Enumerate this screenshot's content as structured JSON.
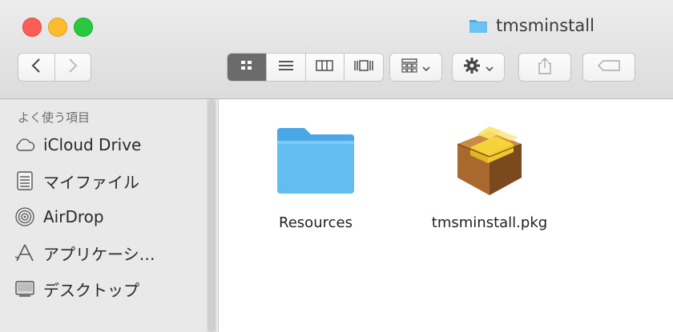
{
  "window": {
    "title": "tmsminstall"
  },
  "toolbar": {
    "back_icon": "chevron-left-icon",
    "forward_icon": "chevron-right-icon",
    "view_modes": [
      "icon-view-icon",
      "list-view-icon",
      "column-view-icon",
      "cover-flow-icon"
    ],
    "active_view": "icon-view-icon",
    "arrange_icon": "arrange-grid-icon",
    "action_icon": "gear-icon",
    "share_icon": "share-icon",
    "tag_icon": "tag-icon"
  },
  "sidebar": {
    "section_header": "よく使う項目",
    "items": [
      {
        "label": "iCloud Drive",
        "icon": "cloud-icon"
      },
      {
        "label": "マイファイル",
        "icon": "all-my-files-icon"
      },
      {
        "label": "AirDrop",
        "icon": "airdrop-icon"
      },
      {
        "label": "アプリケーシ…",
        "icon": "applications-icon"
      },
      {
        "label": "デスクトップ",
        "icon": "desktop-icon"
      }
    ]
  },
  "files": [
    {
      "name": "Resources",
      "icon": "folder-icon"
    },
    {
      "name": "tmsminstall.pkg",
      "icon": "package-icon"
    }
  ],
  "colors": {
    "folder_blue": "#5cb8ee",
    "close": "#fc5f57",
    "minimize": "#fdbc2e",
    "zoom": "#28c840"
  }
}
